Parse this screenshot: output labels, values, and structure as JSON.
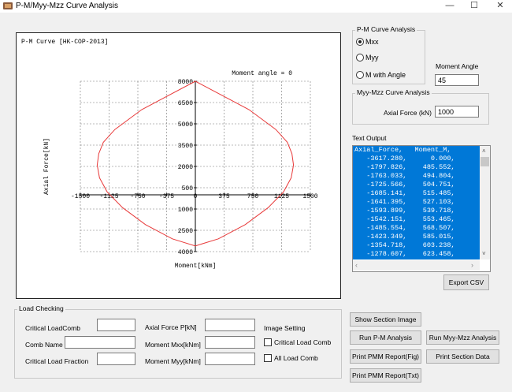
{
  "window": {
    "title": "P-M/Myy-Mzz Curve Analysis",
    "minimize": "—",
    "maximize": "☐",
    "close": "✕"
  },
  "plot": {
    "title": "P-M Curve [HK-COP-2013]",
    "angle_label": "Moment angle = 0",
    "xlabel": "Moment[kNm]",
    "ylabel": "Axial Force[kN]",
    "x_ticks": [
      "-1500",
      "-1125",
      "-750",
      "-375",
      "0",
      "375",
      "750",
      "1125",
      "1500"
    ],
    "y_ticks": [
      "8000",
      "6500",
      "5000",
      "3500",
      "2000",
      "500",
      "1000",
      "2500",
      "4000"
    ]
  },
  "chart_data": {
    "type": "line",
    "title": "P-M Curve [HK-COP-2013]",
    "xlabel": "Moment[kNm]",
    "ylabel": "Axial Force[kN]",
    "xlim": [
      -1500,
      1500
    ],
    "ylim": [
      -4000,
      8000
    ],
    "series": [
      {
        "color": "#e83b3b",
        "x": [
          0,
          700,
          1050,
          1200,
          1260,
          1280,
          1250,
          1150,
          950,
          650,
          300,
          0,
          -300,
          -650,
          -950,
          -1150,
          -1250,
          -1280,
          -1260,
          -1200,
          -1050,
          -700,
          0
        ],
        "y": [
          8000,
          6000,
          4600,
          3700,
          2900,
          2100,
          1200,
          200,
          -900,
          -2100,
          -3100,
          -3600,
          -3100,
          -2100,
          -900,
          200,
          1200,
          2100,
          2900,
          3700,
          4600,
          6000,
          8000
        ]
      }
    ]
  },
  "pm_group": {
    "title": "P-M Curve Analysis",
    "options": [
      "Mxx",
      "Myy",
      "M with Angle"
    ],
    "selected": 0,
    "moment_angle_label": "Moment Angle",
    "moment_angle_value": "45"
  },
  "myy_group": {
    "title": "Myy-Mzz Curve Analysis",
    "axial_label": "Axial Force (kN)",
    "axial_value": "1000"
  },
  "text_output": {
    "label": "Text Output",
    "lines": [
      "Axial_Force,   Moment_M,",
      "   -3617.280,      0.000,",
      "   -1797.826,    485.552,",
      "   -1763.033,    494.804,",
      "   -1725.566,    504.751,",
      "   -1685.141,    515.485,",
      "   -1641.395,    527.103,",
      "   -1593.899,    539.718,",
      "   -1542.151,    553.465,",
      "   -1485.554,    568.507,",
      "   -1423.349,    585.015,",
      "   -1354.718,    603.238,",
      "   -1278.607,    623.458,"
    ],
    "export_button": "Export CSV"
  },
  "load_checking": {
    "title": "Load Checking",
    "critical_loadcomb_label": "Critical LoadComb",
    "comb_name_label": "Comb Name",
    "critical_load_fraction_label": "Critical Load Fraction",
    "axial_force_label": "Axial Force P[kN]",
    "moment_mxx_label": "Moment Mxx[kNm]",
    "moment_myy_label": "Moment Myy[kNm]",
    "image_setting_label": "Image Setting",
    "critical_load_comb_check": "Critical Load Comb",
    "all_load_comb_check": "All Load Comb"
  },
  "buttons": {
    "show_section_image": "Show Section Image",
    "run_pm": "Run P-M Analysis",
    "run_myy": "Run Myy-Mzz Analysis",
    "print_fig": "Print PMM Report(Fig)",
    "print_section": "Print Section Data",
    "print_txt": "Print PMM Report(Txt)"
  }
}
